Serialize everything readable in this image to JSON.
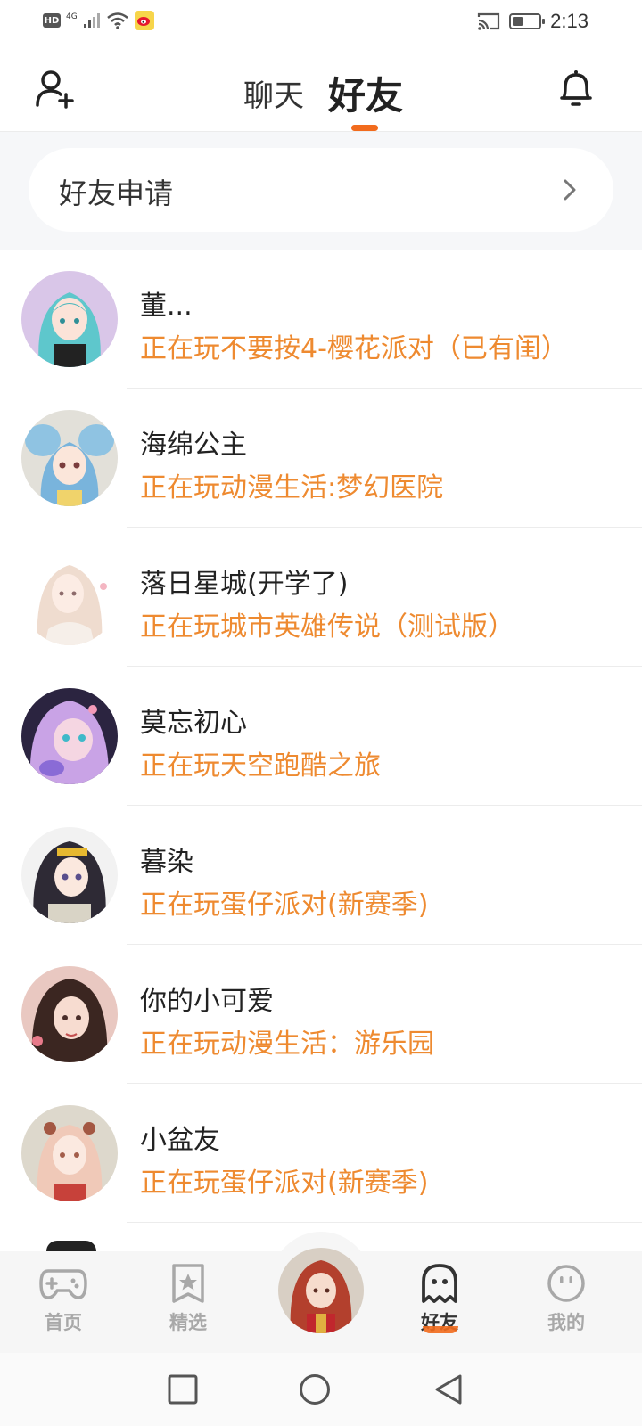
{
  "status_bar": {
    "hd": "HD",
    "network": "4G",
    "time": "2:13",
    "battery_level": 0.4
  },
  "header": {
    "tabs": [
      {
        "label": "聊天",
        "active": false
      },
      {
        "label": "好友",
        "active": true
      }
    ],
    "accent_color": "#f26b1d"
  },
  "friend_request": {
    "label": "好友申请"
  },
  "friends": [
    {
      "name": "董...",
      "status": "正在玩不要按4-樱花派对（已有闺）",
      "avatar_color": "#8fd6da"
    },
    {
      "name": "海绵公主",
      "status": "正在玩动漫生活:梦幻医院",
      "avatar_color": "#9cc7e4"
    },
    {
      "name": "落日星城(开学了)",
      "status": "正在玩城市英雄传说（测试版）",
      "avatar_color": "#f1dcd3"
    },
    {
      "name": "莫忘初心",
      "status": "正在玩天空跑酷之旅",
      "avatar_color": "#b48ad6"
    },
    {
      "name": "暮染",
      "status": "正在玩蛋仔派对(新赛季)",
      "avatar_color": "#3a3340"
    },
    {
      "name": "你的小可爱",
      "status": "正在玩动漫生活：游乐园",
      "avatar_color": "#c98a6f"
    },
    {
      "name": "小盆友",
      "status": "正在玩蛋仔派对(新赛季)",
      "avatar_color": "#e7cfc4"
    }
  ],
  "bottom_nav": {
    "items": [
      {
        "label": "首页",
        "icon": "gamepad-icon",
        "active": false
      },
      {
        "label": "精选",
        "icon": "star-bookmark-icon",
        "active": false
      },
      {
        "label": "好友",
        "icon": "ghost-icon",
        "active": true
      },
      {
        "label": "我的",
        "icon": "smiley-face-icon",
        "active": false
      }
    ],
    "status_color": "#ee8a30"
  },
  "system_nav": {
    "icons": [
      "square-icon",
      "circle-icon",
      "triangle-back-icon"
    ]
  }
}
